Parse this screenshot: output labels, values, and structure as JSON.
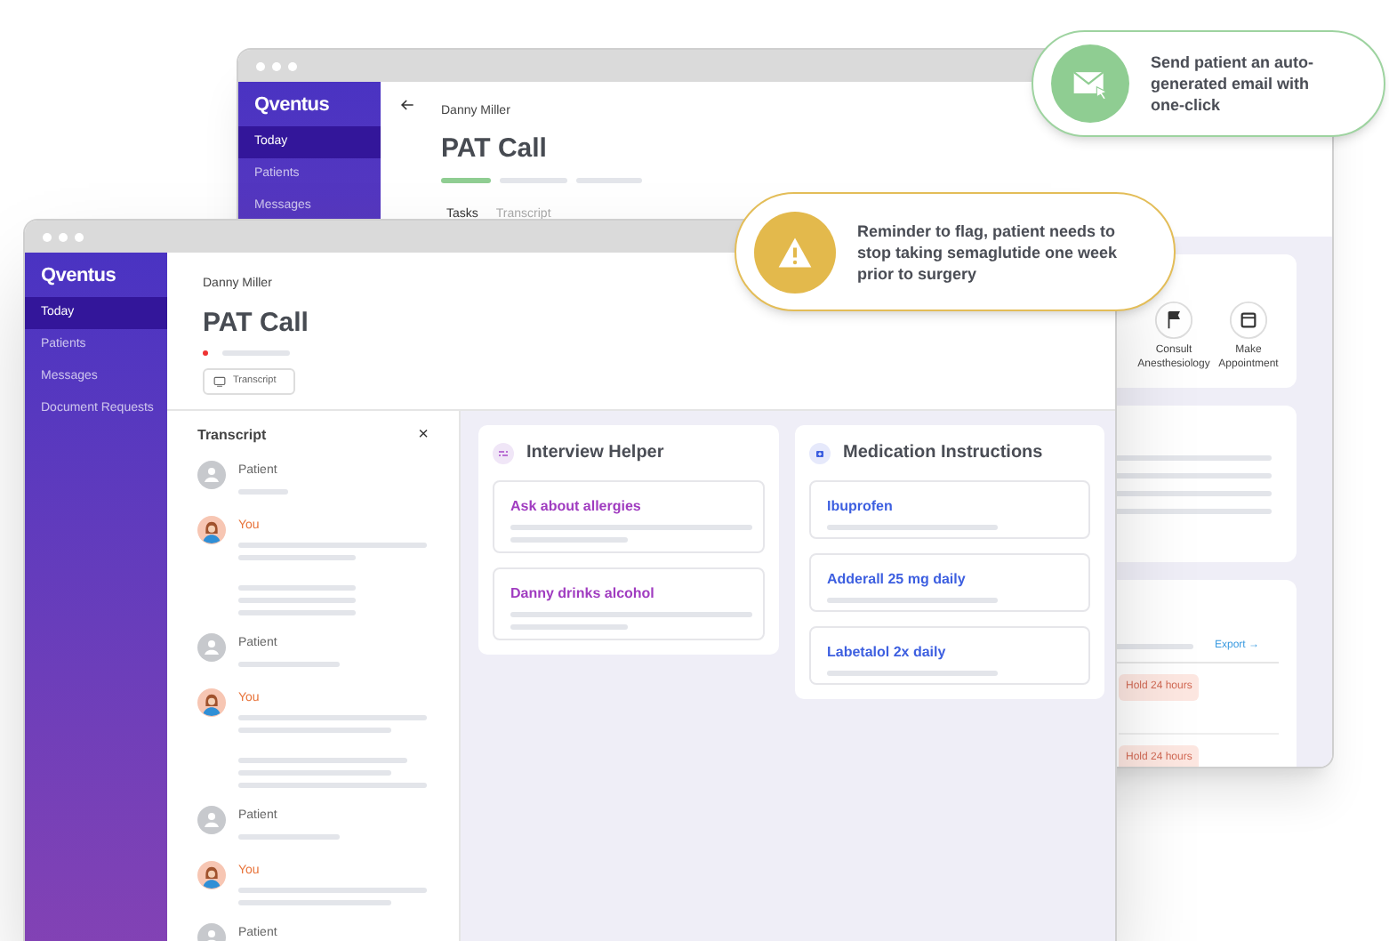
{
  "back_window": {
    "logo": "Qventus",
    "sidebar": {
      "items": [
        {
          "label": "Today",
          "selected": true
        },
        {
          "label": "Patients",
          "selected": false
        },
        {
          "label": "Messages",
          "selected": false
        }
      ]
    },
    "patient_name": "Danny Miller",
    "title": "PAT Call",
    "steps": [
      {
        "complete": true
      },
      {
        "complete": false
      },
      {
        "complete": false
      }
    ],
    "tabs": [
      {
        "label": "Tasks",
        "selected": true
      },
      {
        "label": "Transcript",
        "selected": false
      }
    ],
    "actions": [
      {
        "kind": "flag",
        "label": "Consult Anesthesiology"
      },
      {
        "kind": "calendar",
        "label": "Make Appointment"
      }
    ],
    "export_link": "Export →",
    "badges": [
      "Hold 24 hours",
      "Hold 24 hours"
    ]
  },
  "front_window": {
    "logo": "Qventus",
    "sidebar": {
      "items": [
        {
          "label": "Today",
          "selected": true
        },
        {
          "label": "Patients",
          "selected": false
        },
        {
          "label": "Messages",
          "selected": false
        },
        {
          "label": "Document Requests",
          "selected": false
        }
      ]
    },
    "patient_name": "Danny Miller",
    "title": "PAT Call",
    "transcript_button": "Transcript",
    "transcript": {
      "title": "Transcript",
      "close": "×",
      "entries": [
        {
          "kind": "patient",
          "speaker": "Patient"
        },
        {
          "kind": "you",
          "speaker": "You"
        },
        {
          "kind": "patient",
          "speaker": "Patient"
        },
        {
          "kind": "you",
          "speaker": "You"
        },
        {
          "kind": "patient",
          "speaker": "Patient"
        },
        {
          "kind": "you",
          "speaker": "You"
        },
        {
          "kind": "patient",
          "speaker": "Patient"
        }
      ]
    },
    "interview_helper": {
      "title": "Interview Helper",
      "items": [
        "Ask about allergies",
        "Danny drinks alcohol"
      ]
    },
    "medication_instructions": {
      "title": "Medication Instructions",
      "items": [
        "Ibuprofen",
        "Adderall 25 mg daily",
        "Labetalol 2x daily"
      ]
    }
  },
  "callouts": [
    {
      "kind": "email",
      "text": "Send patient an auto-generated email with one-click",
      "color": "#8fcd92"
    },
    {
      "kind": "warning",
      "text": "Reminder to flag, patient needs to stop taking semaglutide one week prior to surgery",
      "color": "#e3b94c"
    }
  ]
}
